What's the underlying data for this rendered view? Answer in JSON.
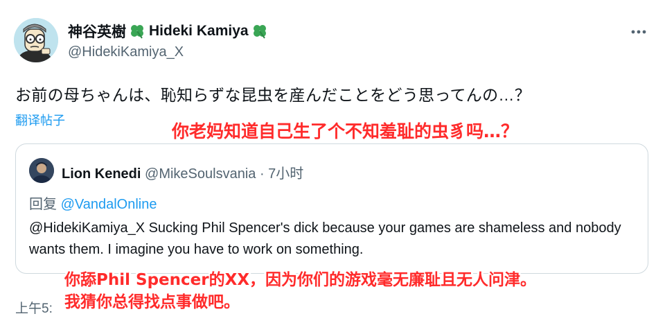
{
  "author": {
    "display_name_jp": "神谷英樹",
    "display_name_en": "Hideki Kamiya",
    "handle": "@HidekiKamiya_X"
  },
  "tweet": {
    "text": "お前の母ちゃんは、恥知らずな昆虫を産んだことをどう思ってんの…？",
    "translate_label": "翻译帖子",
    "timestamp": "上午5:"
  },
  "quote": {
    "name": "Lion Kenedi",
    "meta": " @MikeSoulsvania · 7小时",
    "reply_prefix": "回复 ",
    "reply_mention": "@VandalOnline",
    "body": "@HidekiKamiya_X Sucking Phil Spencer's dick because your games are shameless and nobody wants them. I imagine you have to work on something."
  },
  "overlays": {
    "tweet_translation": "你老妈知道自己生了个不知羞耻的虫豸吗…？",
    "quote_translation_line1": "你舔Phil Spencer的XX，因为你们的游戏毫无廉耻且无人问津。",
    "quote_translation_line2": "我猜你总得找点事做吧。"
  },
  "icons": {
    "clover": "four-leaf-clover-icon",
    "more": "more-options-icon"
  },
  "colors": {
    "link": "#1d9bf0",
    "secondary_text": "#536471",
    "primary_text": "#0f1419",
    "overlay_text": "#ff2b2b",
    "clover": "#3aa655",
    "card_border": "#cfd9de"
  }
}
